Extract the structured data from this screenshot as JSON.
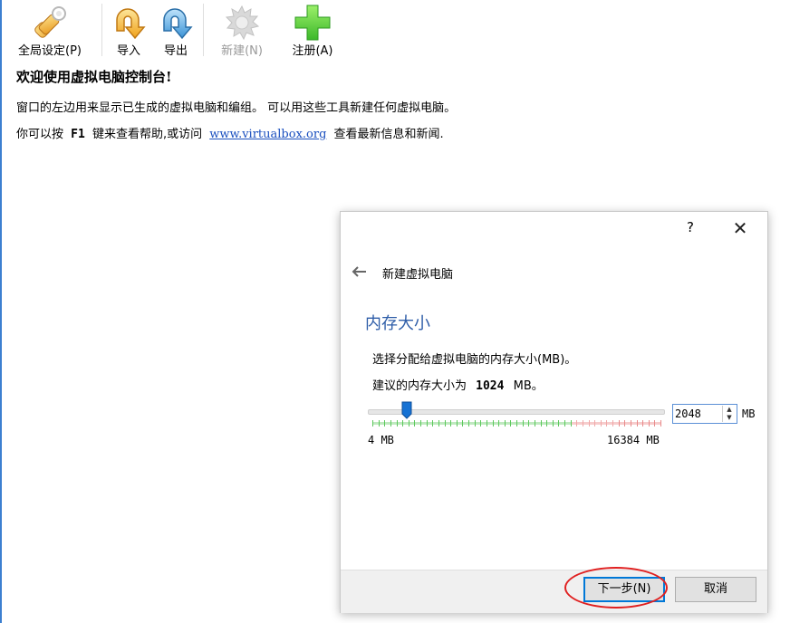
{
  "toolbar": {
    "items": [
      {
        "label": "全局设定(P)",
        "icon": "preferences-icon",
        "enabled": true
      },
      {
        "label": "导入",
        "icon": "import-icon",
        "enabled": true
      },
      {
        "label": "导出",
        "icon": "export-icon",
        "enabled": true
      },
      {
        "label": "新建(N)",
        "icon": "new-gear-icon",
        "enabled": false
      },
      {
        "label": "注册(A)",
        "icon": "add-plus-icon",
        "enabled": true
      }
    ]
  },
  "welcome": {
    "title": "欢迎使用虚拟电脑控制台!",
    "line1": "窗口的左边用来显示已生成的虚拟电脑和编组。 可以用这些工具新建任何虚拟电脑。",
    "line2_pre": "你可以按",
    "line2_key": "F1",
    "line2_mid": "键来查看帮助,或访问",
    "line2_link": "www.virtualbox.org",
    "line2_post": "查看最新信息和新闻."
  },
  "dialog": {
    "help_label": "?",
    "close_label": "✕",
    "header_title": "新建虚拟电脑",
    "section_title": "内存大小",
    "description": "选择分配给虚拟电脑的内存大小(MB)。",
    "recommend_pre": "建议的内存大小为",
    "recommend_value": "1024",
    "recommend_unit": "MB。",
    "memory": {
      "value": "2048",
      "unit": "MB",
      "min_label": "4 MB",
      "max_label": "16384 MB",
      "min": 4,
      "max": 16384,
      "current": 2048
    },
    "buttons": {
      "next": "下一步(N)",
      "cancel": "取消"
    }
  },
  "colors": {
    "accent": "#0078d7",
    "section_title": "#2e5da8",
    "link": "#1a4fbf",
    "annotation": "#e02020",
    "zone_green": "#5cc85c",
    "zone_red": "#e88a8a"
  }
}
